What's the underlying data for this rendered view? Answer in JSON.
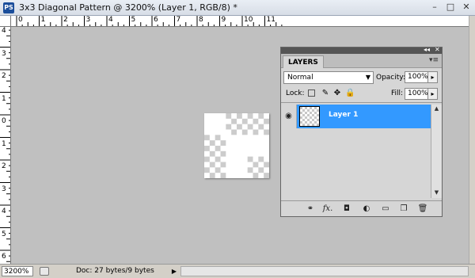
{
  "window": {
    "app_icon": "PS",
    "title": "3x3 Diagonal Pattern @ 3200% (Layer 1, RGB/8) *",
    "controls": [
      "minimize-icon",
      "maximize-icon",
      "close-icon"
    ]
  },
  "rulers": {
    "top_labels": [
      "0",
      "1",
      "2",
      "3",
      "4",
      "5",
      "6",
      "7",
      "8",
      "9",
      "10",
      "11"
    ],
    "left_labels": [
      "4",
      "3",
      "2",
      "1",
      "0",
      "1",
      "2",
      "3",
      "4",
      "5",
      "6"
    ]
  },
  "document": {
    "pattern": "checkerboard-transparency"
  },
  "status": {
    "zoom": "3200%",
    "doc_info": "Doc: 27 bytes/9 bytes",
    "arrow": "▶"
  },
  "layers_panel": {
    "collapse_label": "◂◂",
    "close_label": "✕",
    "tab_label": "LAYERS",
    "menu_icon": "▾≡",
    "blend_mode": "Normal",
    "opacity_label": "Opacity:",
    "opacity_value": "100%",
    "lock_label": "Lock:",
    "fill_label": "Fill:",
    "fill_value": "100%",
    "layers": [
      {
        "name": "Layer 1",
        "visible": true,
        "selected": true
      }
    ],
    "bottom_icons": [
      "link-icon",
      "fx-icon",
      "mask-icon",
      "adjustment-icon",
      "group-folder-icon",
      "new-layer-icon",
      "trash-icon"
    ],
    "fx_label": "fx."
  },
  "colors": {
    "canvas_bg": "#c0c0c0",
    "selection": "#3399ff",
    "panel_bg": "#d6d6d6"
  }
}
